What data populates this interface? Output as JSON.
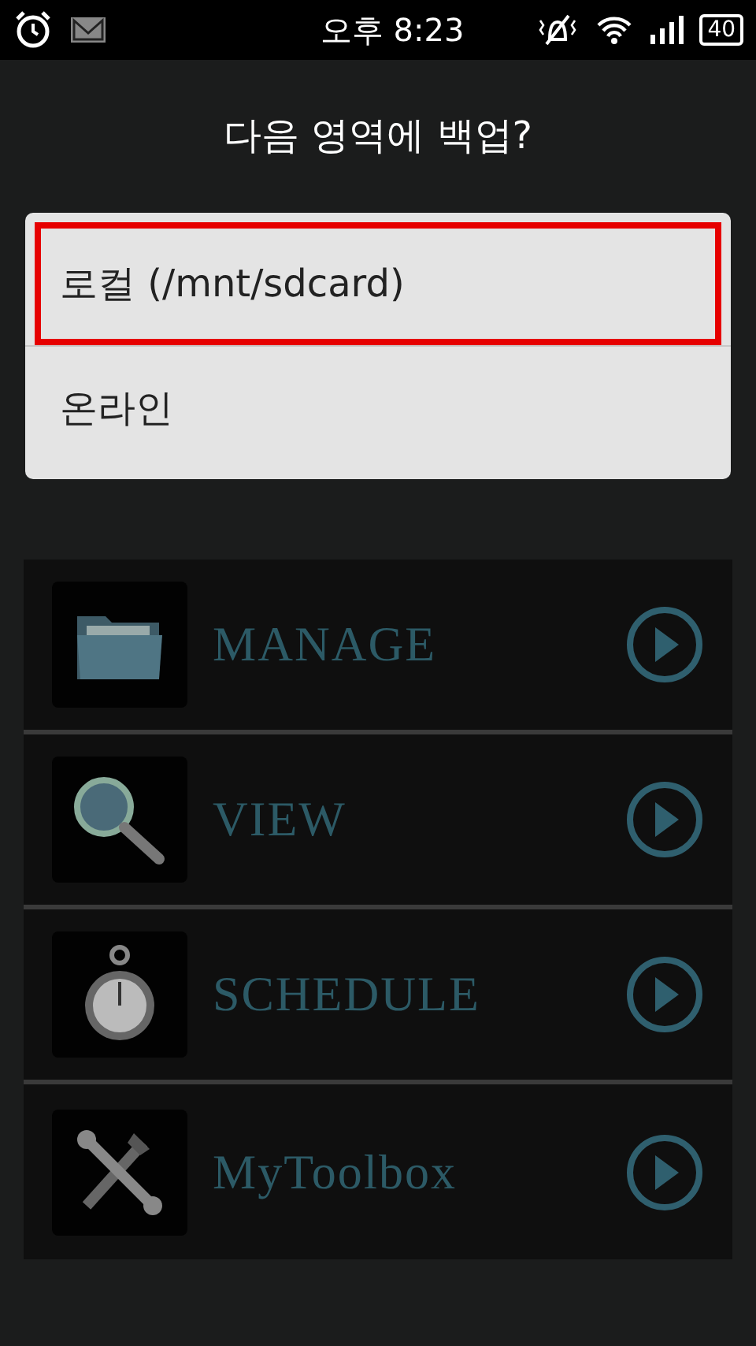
{
  "status_bar": {
    "time": "오후 8:23",
    "battery": "40"
  },
  "dialog": {
    "title": "다음 영역에 백업?",
    "options": [
      {
        "label": "로컬 (/mnt/sdcard)",
        "selected": true
      },
      {
        "label": "온라인",
        "selected": false
      }
    ]
  },
  "menu": {
    "items": [
      {
        "label": "MANAGE",
        "kind": "folder"
      },
      {
        "label": "VIEW",
        "kind": "magnifier"
      },
      {
        "label": "SCHEDULE",
        "kind": "stopwatch"
      },
      {
        "label": "MyToolbox",
        "kind": "tools"
      }
    ]
  }
}
